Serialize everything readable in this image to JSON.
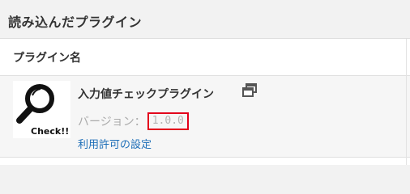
{
  "page": {
    "section_title": "読み込んだプラグイン"
  },
  "table": {
    "column_header": "プラグイン名"
  },
  "plugin": {
    "name": "入力値チェックプラグイン",
    "external_icon": "external-window-icon",
    "thumbnail_icon": "magnifier-check-icon",
    "thumbnail_text": "Check!!",
    "version_label": "バージョン：",
    "version_value": "1.0.0",
    "license_link": "利用許可の設定"
  },
  "colors": {
    "background": "#f2f2f2",
    "link": "#1e6fb8",
    "highlight_border": "#e3001b"
  }
}
